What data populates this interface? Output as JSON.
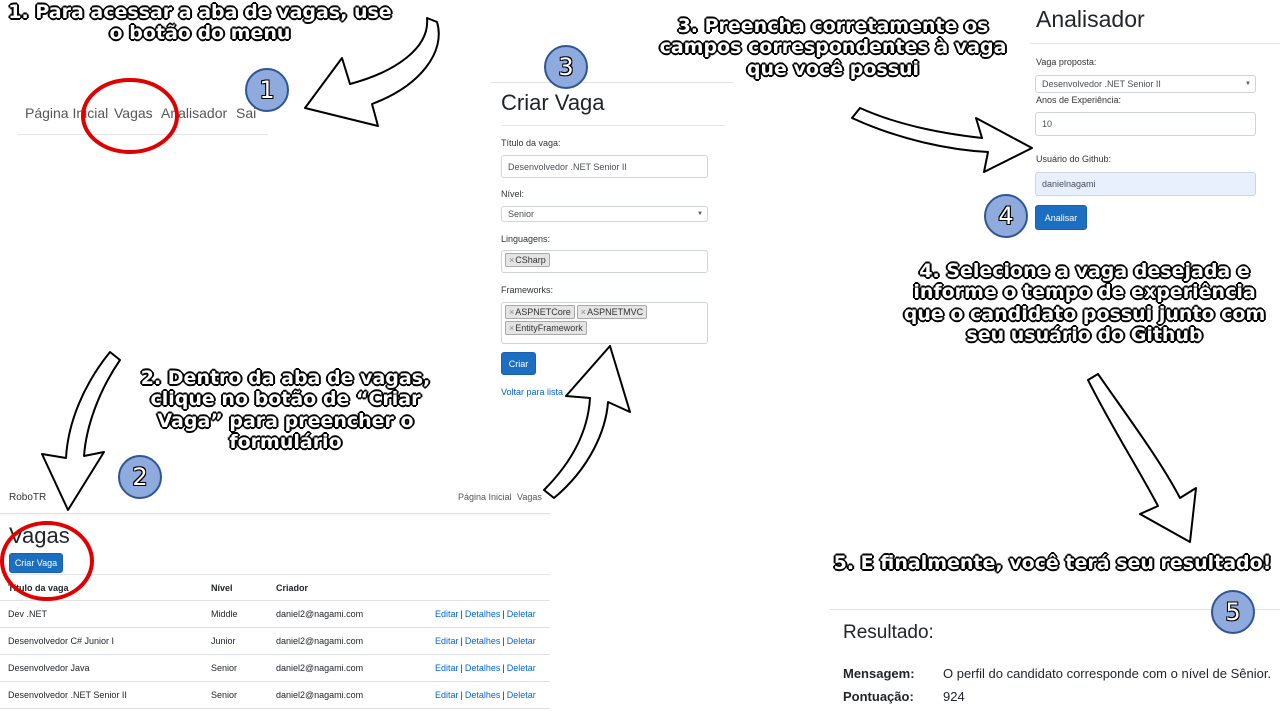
{
  "steps": {
    "step1": "1. Para acessar a aba de vagas, use o botão do menu",
    "step2": "2. Dentro da aba de vagas, clique no botão de “Criar Vaga” para preencher o formulário",
    "step3": "3. Preencha corretamente os campos correspondentes à vaga que você possui",
    "step4": "4. Selecione a vaga desejada e informe o tempo de experiência que o candidato possui junto com seu usuário do Github",
    "step5": "5. E finalmente, você terá seu resultado!"
  },
  "badges": [
    "1",
    "2",
    "3",
    "4",
    "5"
  ],
  "menu": {
    "items": [
      "Página Inicial",
      "Vagas",
      "Analisador",
      "Sair"
    ]
  },
  "vagas_page": {
    "brand": "RoboTR",
    "nav": [
      "Página Inicial",
      "Vagas"
    ],
    "title": "Vagas",
    "create_button": "Criar Vaga",
    "columns": [
      "Título da vaga",
      "Nível",
      "Criador"
    ],
    "rows": [
      {
        "title": "Dev .NET",
        "level": "Middle",
        "creator": "daniel2@nagami.com"
      },
      {
        "title": "Desenvolvedor C# Junior I",
        "level": "Junior",
        "creator": "daniel2@nagami.com"
      },
      {
        "title": "Desenvolvedor Java",
        "level": "Senior",
        "creator": "daniel2@nagami.com"
      },
      {
        "title": "Desenvolvedor .NET Senior II",
        "level": "Senior",
        "creator": "daniel2@nagami.com"
      }
    ],
    "actions": {
      "edit": "Editar",
      "details": "Detalhes",
      "delete": "Deletar",
      "sep": "|"
    }
  },
  "criar_vaga": {
    "title": "Criar Vaga",
    "titulo_label": "Título da vaga:",
    "titulo_value": "Desenvolvedor .NET Senior II",
    "nivel_label": "Nível:",
    "nivel_value": "Senior",
    "linguagens_label": "Linguagens:",
    "linguagens": [
      "CSharp"
    ],
    "frameworks_label": "Frameworks:",
    "frameworks": [
      "ASPNETCore",
      "ASPNETMVC",
      "EntityFramework"
    ],
    "tag_remove": "×",
    "submit": "Criar",
    "back_link": "Voltar para lista"
  },
  "analisador": {
    "title": "Analisador",
    "vaga_label": "Vaga proposta:",
    "vaga_value": "Desenvolvedor .NET Senior II",
    "anos_label": "Anos de Experiência:",
    "anos_value": "10",
    "github_label": "Usuário do Github:",
    "github_value": "danielnagami",
    "submit": "Analisar"
  },
  "resultado": {
    "title": "Resultado:",
    "mensagem_label": "Mensagem:",
    "mensagem_value": "O perfil do candidato corresponde com o nível de Sênior.",
    "pontuacao_label": "Pontuação:",
    "pontuacao_value": "924"
  },
  "colors": {
    "badge_fill": "#8faadc",
    "badge_border": "#2f5597",
    "highlight_circle": "#e00000",
    "primary_button": "#1b6ec2",
    "link": "#0366d6"
  }
}
